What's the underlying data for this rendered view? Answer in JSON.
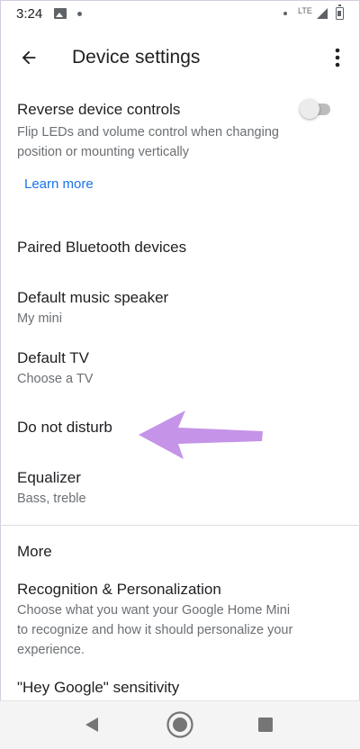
{
  "status_bar": {
    "time": "3:24",
    "network": "LTE"
  },
  "app_bar": {
    "title": "Device settings"
  },
  "reverse_controls": {
    "title": "Reverse device controls",
    "subtitle_line1": "Flip LEDs and volume control when changing",
    "subtitle_line2": "position or mounting vertically",
    "learn_more": "Learn more",
    "enabled": false
  },
  "items": {
    "paired_bluetooth": {
      "title": "Paired Bluetooth devices"
    },
    "default_music": {
      "title": "Default music speaker",
      "subtitle": "My mini"
    },
    "default_tv": {
      "title": "Default TV",
      "subtitle": "Choose a TV"
    },
    "do_not_disturb": {
      "title": "Do not disturb"
    },
    "equalizer": {
      "title": "Equalizer",
      "subtitle": "Bass, treble"
    }
  },
  "more_section": {
    "header": "More",
    "recognition": {
      "title": "Recognition & Personalization",
      "subtitle_line1": "Choose what you want your Google Home Mini",
      "subtitle_line2": "to recognize and how it should personalize your",
      "subtitle_line3": "experience."
    },
    "hey_google": {
      "title": "\"Hey Google\" sensitivity"
    }
  },
  "colors": {
    "accent_link": "#1a73e8",
    "annotation_arrow": "#c08ae6"
  },
  "icons": {
    "back": "arrow-left-icon",
    "more": "more-vert-icon",
    "nav_back": "triangle-back-icon",
    "nav_home": "circle-home-icon",
    "nav_recents": "square-recents-icon"
  }
}
